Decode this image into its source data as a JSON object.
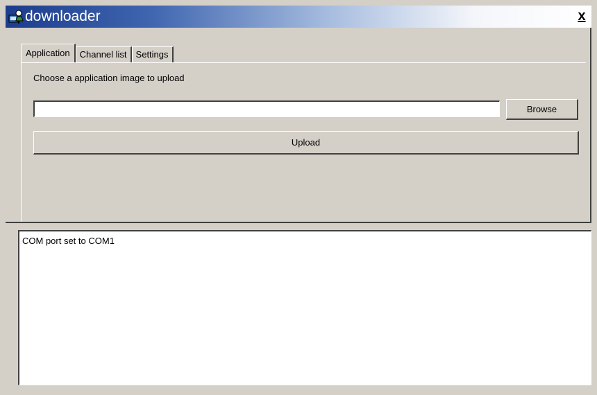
{
  "window": {
    "title": "downloader",
    "close_label": "x",
    "title_gradient": [
      "#1c3c8c",
      "#4066b0",
      "#ffffff"
    ],
    "app_icon": "downloader-app-icon"
  },
  "tabs": [
    {
      "label": "Application",
      "active": true
    },
    {
      "label": "Channel list",
      "active": false
    },
    {
      "label": "Settings",
      "active": false
    }
  ],
  "application_tab": {
    "prompt": "Choose a application image to upload",
    "file_path_value": "",
    "browse_label": "Browse",
    "upload_label": "Upload"
  },
  "log": {
    "lines": [
      "COM port set to COM1"
    ]
  }
}
